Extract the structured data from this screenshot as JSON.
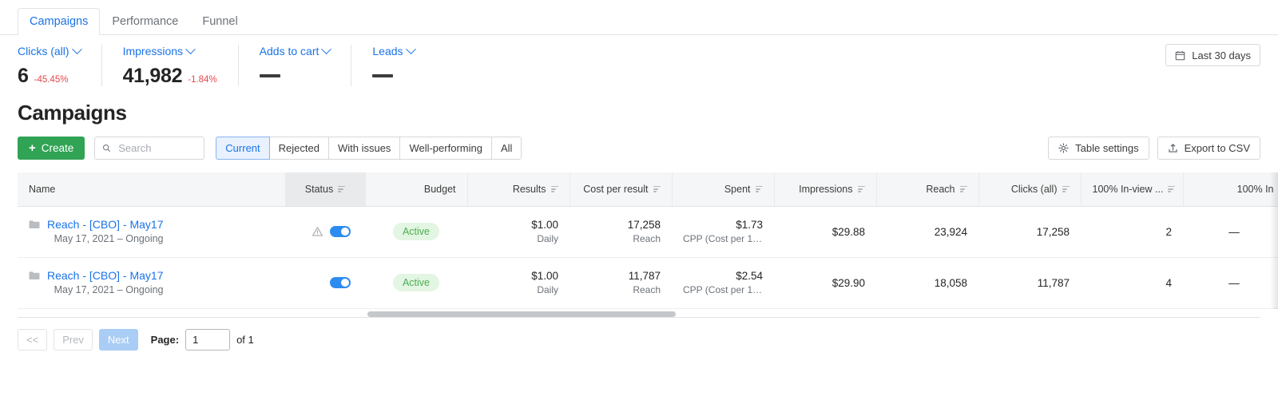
{
  "tabs": [
    {
      "label": "Campaigns",
      "active": true
    },
    {
      "label": "Performance",
      "active": false
    },
    {
      "label": "Funnel",
      "active": false
    }
  ],
  "kpis": [
    {
      "label": "Clicks (all)",
      "value": "6",
      "delta": "-45.45%",
      "empty": false
    },
    {
      "label": "Impressions",
      "value": "41,982",
      "delta": "-1.84%",
      "empty": false
    },
    {
      "label": "Adds to cart",
      "value": "",
      "delta": "",
      "empty": true
    },
    {
      "label": "Leads",
      "value": "",
      "delta": "",
      "empty": true
    }
  ],
  "date_picker": {
    "label": "Last 30 days",
    "icon": "calendar-icon"
  },
  "page_title": "Campaigns",
  "toolbar": {
    "create_label": "Create",
    "search_placeholder": "Search",
    "search_value": "",
    "filters": [
      {
        "label": "Current",
        "active": true
      },
      {
        "label": "Rejected",
        "active": false
      },
      {
        "label": "With issues",
        "active": false
      },
      {
        "label": "Well-performing",
        "active": false
      },
      {
        "label": "All",
        "active": false
      }
    ],
    "table_settings_label": "Table settings",
    "export_label": "Export to CSV"
  },
  "table": {
    "columns": [
      {
        "key": "name",
        "label": "Name",
        "sortable": false,
        "align": "left",
        "highlight": false
      },
      {
        "key": "status",
        "label": "Status",
        "sortable": true,
        "align": "center",
        "highlight": true
      },
      {
        "key": "budget",
        "label": "Budget",
        "sortable": false,
        "align": "right",
        "highlight": false
      },
      {
        "key": "results",
        "label": "Results",
        "sortable": true,
        "align": "right",
        "highlight": false
      },
      {
        "key": "cost_per_result",
        "label": "Cost per result",
        "sortable": true,
        "align": "right",
        "highlight": false
      },
      {
        "key": "spent",
        "label": "Spent",
        "sortable": true,
        "align": "right",
        "highlight": false
      },
      {
        "key": "impressions",
        "label": "Impressions",
        "sortable": true,
        "align": "right",
        "highlight": false
      },
      {
        "key": "reach",
        "label": "Reach",
        "sortable": true,
        "align": "right",
        "highlight": false
      },
      {
        "key": "clicks_all",
        "label": "Clicks (all)",
        "sortable": true,
        "align": "right",
        "highlight": false
      },
      {
        "key": "inview1",
        "label": "100% In-view ...",
        "sortable": true,
        "align": "right",
        "highlight": false
      },
      {
        "key": "inview2",
        "label": "100% In",
        "sortable": false,
        "align": "right",
        "highlight": false
      }
    ],
    "rows": [
      {
        "name": "Reach - [CBO] - May17",
        "dates": "May 17, 2021 – Ongoing",
        "has_warning": true,
        "toggle_on": true,
        "status": "Active",
        "budget": "$1.00",
        "budget_sub": "Daily",
        "results": "17,258",
        "results_sub": "Reach",
        "cost_per_result": "$1.73",
        "cost_per_result_sub": "CPP (Cost per 1,0...",
        "spent": "$29.88",
        "impressions": "23,924",
        "reach": "17,258",
        "clicks_all": "2",
        "inview1": "—",
        "inview2": ""
      },
      {
        "name": "Reach - [CBO] - May17",
        "dates": "May 17, 2021 – Ongoing",
        "has_warning": false,
        "toggle_on": true,
        "status": "Active",
        "budget": "$1.00",
        "budget_sub": "Daily",
        "results": "11,787",
        "results_sub": "Reach",
        "cost_per_result": "$2.54",
        "cost_per_result_sub": "CPP (Cost per 1,0...",
        "spent": "$29.90",
        "impressions": "18,058",
        "reach": "11,787",
        "clicks_all": "4",
        "inview1": "—",
        "inview2": ""
      }
    ]
  },
  "pagination": {
    "first_label": "<<",
    "prev_label": "Prev",
    "next_label": "Next",
    "page_label": "Page:",
    "page_value": "1",
    "of_label": "of 1"
  },
  "colors": {
    "accent_blue": "#1a73e8",
    "create_green": "#31a354",
    "badge_green": "#4caf50",
    "delta_red": "#e5484d",
    "toggle_blue": "#2d8cf0"
  }
}
